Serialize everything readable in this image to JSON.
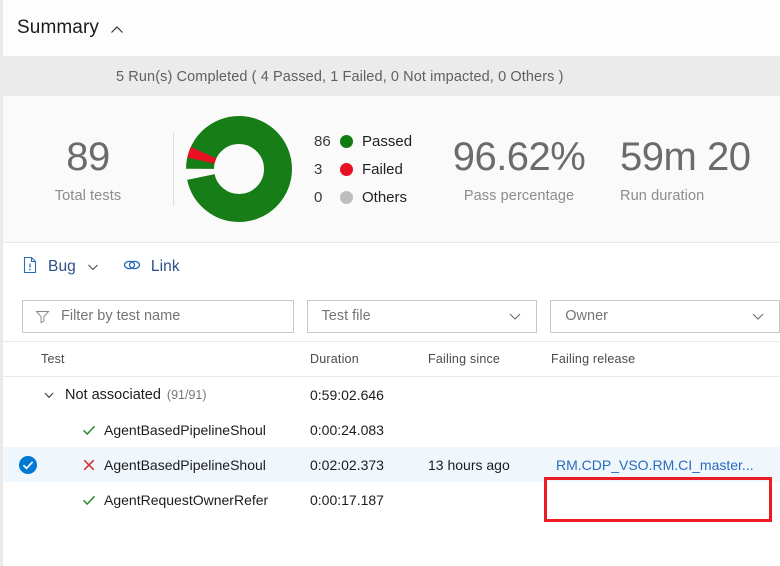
{
  "panel": {
    "title": "Summary",
    "collapse_icon": "chevron-up-icon",
    "runs_banner": "5 Run(s) Completed ( 4 Passed, 1 Failed, 0 Not impacted, 0 Others )"
  },
  "stats": {
    "total": {
      "value": "89",
      "label": "Total tests"
    },
    "pass_percentage": {
      "value": "96.62%",
      "label": "Pass percentage"
    },
    "run_duration": {
      "value": "59m 20",
      "label": "Run duration"
    },
    "legend": [
      {
        "count": "86",
        "label": "Passed",
        "color": "#107c10"
      },
      {
        "count": "3",
        "label": "Failed",
        "color": "#e81123"
      },
      {
        "count": "0",
        "label": "Others",
        "color": "#bebebe"
      }
    ]
  },
  "chart_data": {
    "type": "pie",
    "title": "",
    "categories": [
      "Passed",
      "Failed",
      "Others"
    ],
    "values": [
      86,
      3,
      0
    ],
    "colors": [
      "#177d17",
      "#e81123",
      "#bebebe"
    ],
    "donut": true,
    "total": 89,
    "legend_position": "right"
  },
  "toolbar": {
    "bug": {
      "label": "Bug",
      "icon": "bug-file-icon",
      "menu_icon": "chevron-down-icon"
    },
    "link": {
      "label": "Link",
      "icon": "link-chain-icon"
    }
  },
  "filters": {
    "test_name": {
      "placeholder": "Filter by test name",
      "icon": "funnel-icon"
    },
    "test_file": {
      "value": "Test file",
      "icon": "chevron-down-icon"
    },
    "owner": {
      "value": "Owner",
      "icon": "chevron-down-icon"
    }
  },
  "table": {
    "columns": [
      "Test",
      "Duration",
      "Failing since",
      "Failing release"
    ],
    "rows": [
      {
        "type": "group",
        "expanded": true,
        "name": "Not associated",
        "count": "(91/91)",
        "duration": "0:59:02.646",
        "failing_since": "",
        "failing_release": "",
        "selected": false
      },
      {
        "type": "test",
        "status": "passed",
        "name": "AgentBasedPipelineShoul",
        "duration": "0:00:24.083",
        "failing_since": "",
        "failing_release": "",
        "selected": false
      },
      {
        "type": "test",
        "status": "failed",
        "name": "AgentBasedPipelineShoul",
        "duration": "0:02:02.373",
        "failing_since": "13 hours ago",
        "failing_release": "RM.CDP_VSO.RM.CI_master...",
        "selected": true
      },
      {
        "type": "test",
        "status": "passed",
        "name": "AgentRequestOwnerRefer",
        "duration": "0:00:17.187",
        "failing_since": "",
        "failing_release": "",
        "selected": false
      }
    ]
  },
  "annotation": {
    "highlight_color": "#ec1c24",
    "target": "failing-release-link"
  }
}
